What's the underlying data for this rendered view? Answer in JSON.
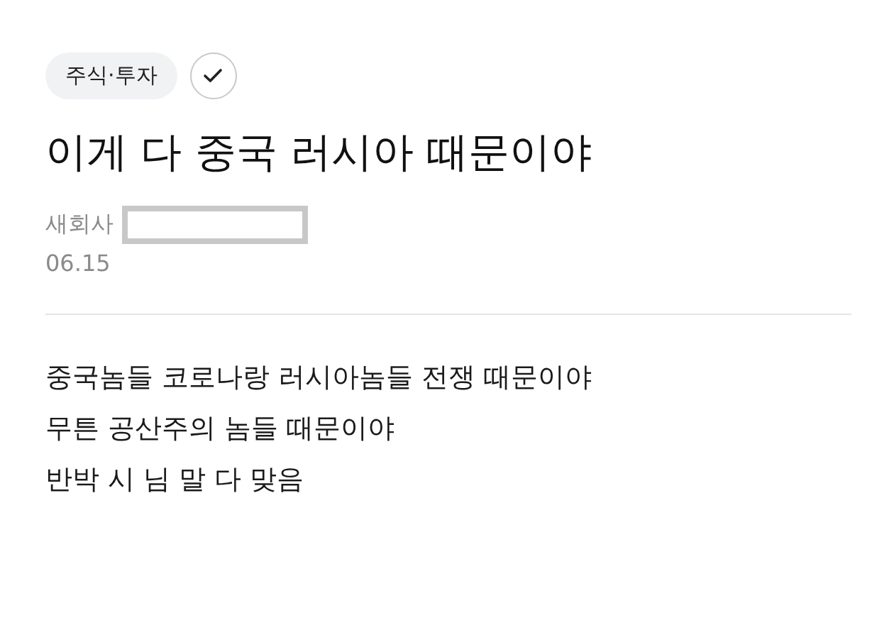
{
  "category": {
    "label": "주식·투자"
  },
  "title": "이게 다 중국 러시아 때문이야",
  "author": {
    "name": "새회사"
  },
  "date": "06.15",
  "body": [
    "중국놈들 코로나랑 러시아놈들 전쟁 때문이야",
    "무튼 공산주의 놈들 때문이야",
    "반박 시 님 말 다 맞음"
  ]
}
